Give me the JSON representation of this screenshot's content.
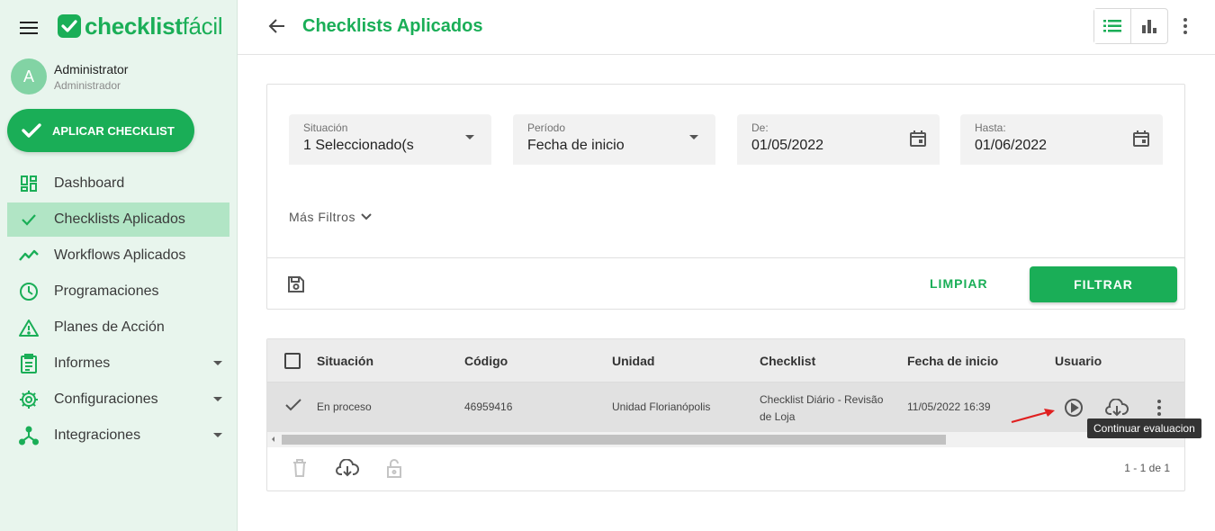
{
  "brand": {
    "name_bold": "checklist",
    "name_light": "fácil",
    "color": "#1aae57"
  },
  "user": {
    "initial": "A",
    "name": "Administrator",
    "role": "Administrador"
  },
  "sidebar": {
    "apply_button": "APLICAR CHECKLIST",
    "items": [
      {
        "label": "Dashboard",
        "icon": "dashboard-icon"
      },
      {
        "label": "Checklists Aplicados",
        "icon": "check-icon",
        "active": true
      },
      {
        "label": "Workflows Aplicados",
        "icon": "trending-icon"
      },
      {
        "label": "Programaciones",
        "icon": "clock-icon"
      },
      {
        "label": "Planes de Acción",
        "icon": "warning-icon"
      },
      {
        "label": "Informes",
        "icon": "clipboard-icon",
        "expandable": true
      },
      {
        "label": "Configuraciones",
        "icon": "gear-icon",
        "expandable": true
      },
      {
        "label": "Integraciones",
        "icon": "hub-icon",
        "expandable": true
      }
    ]
  },
  "header": {
    "title": "Checklists Aplicados"
  },
  "filters": {
    "situacion": {
      "label": "Situación",
      "value": "1 Seleccionado(s"
    },
    "periodo": {
      "label": "Período",
      "value": "Fecha de inicio"
    },
    "desde": {
      "label": "De:",
      "value": "01/05/2022"
    },
    "hasta": {
      "label": "Hasta:",
      "value": "01/06/2022"
    },
    "more_filters": "Más Filtros",
    "clear_label": "LIMPIAR",
    "apply_label": "FILTRAR"
  },
  "table": {
    "columns": [
      "Situación",
      "Código",
      "Unidad",
      "Checklist",
      "Fecha de inicio",
      "Usuario"
    ],
    "rows": [
      {
        "situacion": "En proceso",
        "codigo": "46959416",
        "unidad": "Unidad Florianópolis",
        "checklist_line1": "Checklist Diário - Revisão",
        "checklist_line2": "de Loja",
        "fecha": "11/05/2022 16:39"
      }
    ],
    "pagination": "1 - 1 de 1",
    "tooltip": "Continuar evaluacion"
  }
}
